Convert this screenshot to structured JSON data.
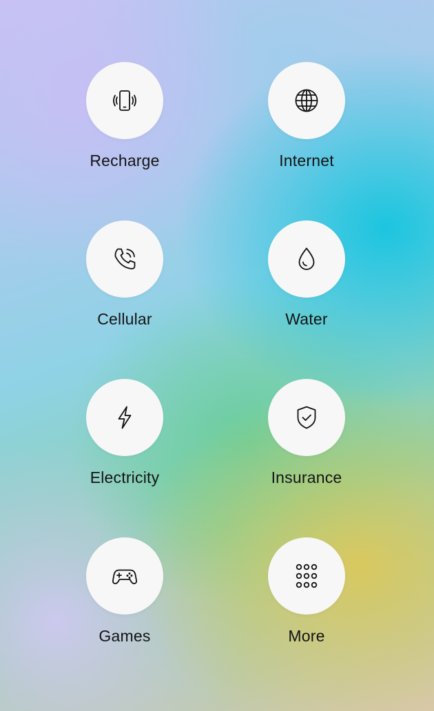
{
  "services": [
    {
      "label": "Recharge",
      "icon": "phone-vibrate-icon"
    },
    {
      "label": "Internet",
      "icon": "globe-icon"
    },
    {
      "label": "Cellular",
      "icon": "phone-call-icon"
    },
    {
      "label": "Water",
      "icon": "water-drop-icon"
    },
    {
      "label": "Electricity",
      "icon": "lightning-bolt-icon"
    },
    {
      "label": "Insurance",
      "icon": "shield-check-icon"
    },
    {
      "label": "Games",
      "icon": "gamepad-icon"
    },
    {
      "label": "More",
      "icon": "grid-dots-icon"
    }
  ]
}
